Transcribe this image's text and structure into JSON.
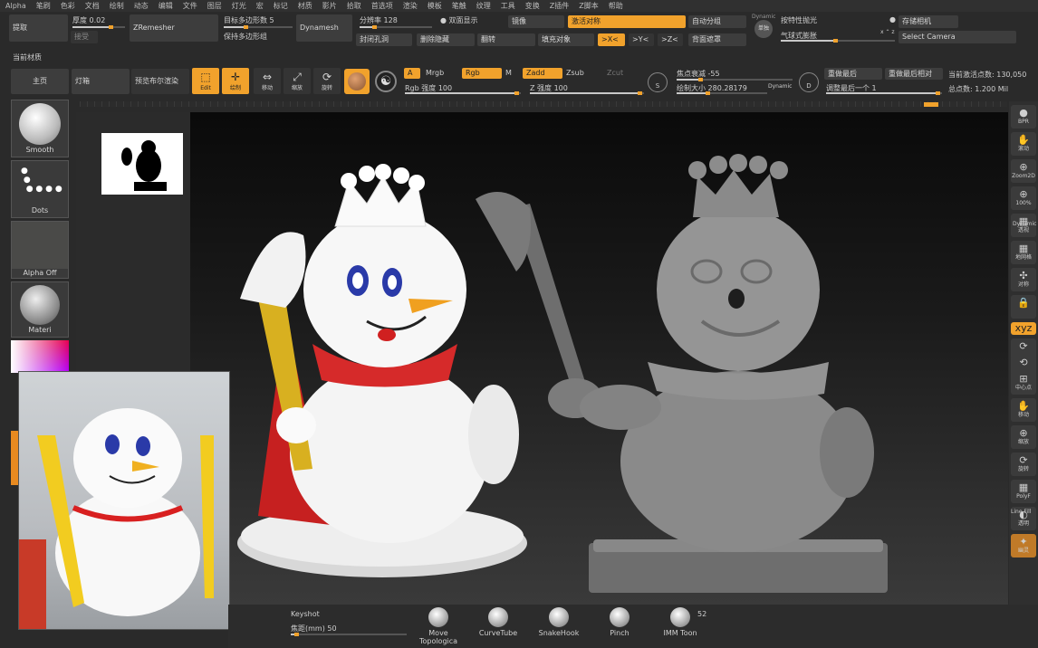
{
  "menu": [
    "Alpha",
    "笔刷",
    "色彩",
    "文档",
    "绘制",
    "动态",
    "编辑",
    "文件",
    "图层",
    "灯光",
    "宏",
    "标记",
    "材质",
    "影片",
    "拾取",
    "首选项",
    "渲染",
    "模板",
    "笔触",
    "纹理",
    "工具",
    "变换",
    "Z插件",
    "Z脚本",
    "帮助"
  ],
  "top": {
    "extract": "提取",
    "accept": "接受",
    "thickness_label": "厚度",
    "thickness_value": "0.02",
    "zremesher": "ZRemesher",
    "target_poly_label": "目标多边形数",
    "target_poly_value": "5",
    "keep_groups": "保持多边形组",
    "dynamesh": "Dynamesh",
    "resolution_label": "分辨率",
    "resolution_value": "128",
    "double_display": "双面显示",
    "close_holes": "封闭孔洞",
    "delete_hidden": "删除隐藏",
    "mirror": "镜像",
    "flip": "翻转",
    "activate_symmetry": "激活对称",
    "fill_object": "填充对象",
    "sym_x": ">X<",
    "sym_y": ">Y<",
    "sym_z": ">Z<",
    "auto_groups": "自动分组",
    "backface_mask": "背面遮罩",
    "dynamic_tag": "Dynamic",
    "solo": "单独",
    "dynamic_push": "按特性抛光",
    "balloon": "气球式膨胀",
    "save_camera": "存储相机",
    "select_camera": "Select Camera"
  },
  "row2": {
    "current_material": "当前材质",
    "main": "主页",
    "lightbox": "灯箱",
    "preview_bpr": "预览布尔渲染",
    "edit_label": "Edit",
    "draw_label": "绘制",
    "move_label": "移动",
    "scale_label": "缩放",
    "rotate_label": "旋转",
    "a_tag": "A",
    "mrgb": "Mrgb",
    "rgb": "Rgb",
    "m": "M",
    "zadd": "Zadd",
    "zsub": "Zsub",
    "zcut": "Zcut",
    "rgb_intensity_label": "Rgb 强度",
    "rgb_intensity_value": "100",
    "z_intensity_label": "Z 强度",
    "z_intensity_value": "100",
    "s_tag": "S",
    "focal_shift_label": "焦点衰减",
    "focal_shift_value": "-55",
    "draw_size_label": "绘制大小",
    "draw_size_value": "280.28179",
    "dynamic": "Dynamic",
    "d_tag": "D",
    "redo_last": "重做最后",
    "redo_last_rel": "重做最后相对",
    "adjust_last_label": "调整最后一个",
    "adjust_last_value": "1",
    "active_points_label": "当前激活点数:",
    "active_points_value": "130,050",
    "total_points_label": "总点数:",
    "total_points_value": "1.200 Mil"
  },
  "left": {
    "smooth": "Smooth",
    "dots": "Dots",
    "alpha_off": "Alpha Off",
    "material": "Materi"
  },
  "right_shelf": [
    {
      "name": "bpr",
      "glyph": "●",
      "label": "BPR"
    },
    {
      "name": "scroll",
      "glyph": "✋",
      "label": "滚动"
    },
    {
      "name": "zoom2d",
      "glyph": "⊕",
      "label": "Zoom2D"
    },
    {
      "name": "zoom100",
      "glyph": "⊕",
      "label": "100%"
    },
    {
      "name": "dynamic-persp",
      "glyph": "▦",
      "label": "透视"
    },
    {
      "name": "floor",
      "glyph": "▦",
      "label": "地网格"
    },
    {
      "name": "sym-local",
      "glyph": "✣",
      "label": "对称"
    },
    {
      "name": "lock",
      "glyph": "🔒",
      "label": ""
    },
    {
      "name": "xyz",
      "glyph": "xyz",
      "label": ""
    },
    {
      "name": "rot-y",
      "glyph": "⟳",
      "label": ""
    },
    {
      "name": "rot-z",
      "glyph": "⟲",
      "label": ""
    },
    {
      "name": "frame",
      "glyph": "⊞",
      "label": "中心点"
    },
    {
      "name": "move",
      "glyph": "✋",
      "label": "移动"
    },
    {
      "name": "zoom",
      "glyph": "⊕",
      "label": "缩放"
    },
    {
      "name": "rotate",
      "glyph": "⟳",
      "label": "旋转"
    },
    {
      "name": "polyf",
      "glyph": "▦",
      "label": "PolyF"
    },
    {
      "name": "transp",
      "glyph": "◐",
      "label": "透明"
    },
    {
      "name": "ghost",
      "glyph": "✦",
      "label": "幽灵"
    }
  ],
  "right_extra": {
    "dynamic": "Dynamic",
    "line_fill": "Line Fill"
  },
  "bottom": {
    "keyshot": "Keyshot",
    "focal_length_label": "焦距(mm)",
    "focal_length_value": "50",
    "tools": [
      "Move Topologica",
      "CurveTube",
      "SnakeHook",
      "Pinch",
      "IMM Toon"
    ],
    "count": "52"
  },
  "colors": {
    "accent": "#f1a22c",
    "panel": "#3d3d3d",
    "background": "#2a2a2a"
  }
}
